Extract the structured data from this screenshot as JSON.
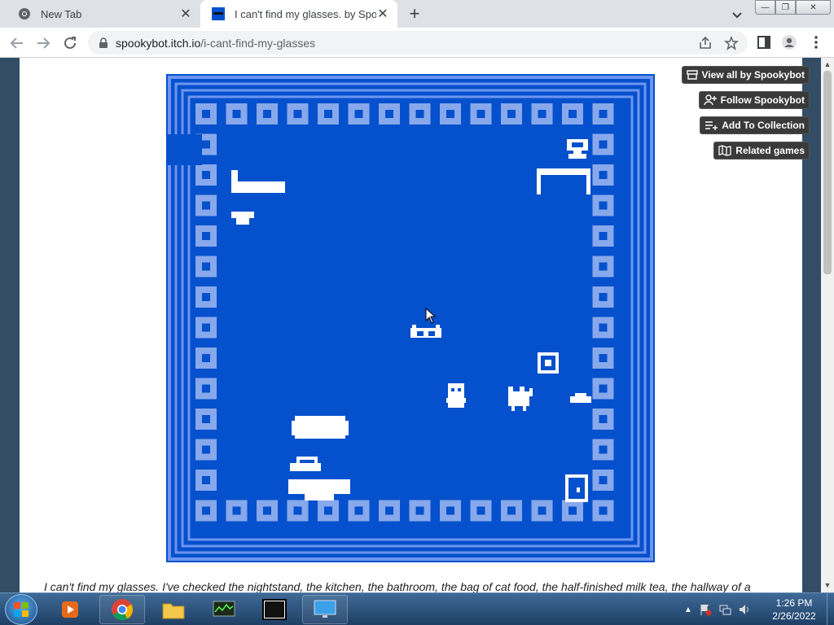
{
  "browser": {
    "tabs": [
      {
        "title": "New Tab",
        "icon": "chrome-icon",
        "active": false
      },
      {
        "title": "I can't find my glasses. by Spookybot",
        "icon": "itch-game-favicon",
        "active": true
      }
    ],
    "address": {
      "host": "spookybot.itch.io",
      "path": "/i-cant-find-my-glasses"
    }
  },
  "page": {
    "side_buttons": [
      {
        "label": "View all by Spookybot",
        "icon": "itch-logo-icon"
      },
      {
        "label": "Follow Spookybot",
        "icon": "follow-user-icon"
      },
      {
        "label": "Add To Collection",
        "icon": "add-collection-icon"
      },
      {
        "label": "Related games",
        "icon": "map-icon"
      }
    ],
    "description": "I can't find my glasses. I've checked the nightstand, the kitchen, the bathroom, the bag of cat food, the half-finished milk tea, the hallway of a"
  },
  "game": {
    "colors": {
      "background": "#0550cc",
      "border_light": "#6d95f0",
      "tile": "#88a8ec",
      "sprite": "#ffffff"
    }
  },
  "taskbar": {
    "clock_time": "1:26 PM",
    "clock_date": "2/26/2022",
    "items": [
      "windows-media-player-icon",
      "chrome-icon",
      "file-explorer-icon",
      "task-manager-icon",
      "7zip-icon",
      "remote-desktop-icon"
    ]
  },
  "colors": {
    "page_bg": "#324d65",
    "button_bg": "#3a3a3a",
    "taskbar": "#2a5182"
  }
}
